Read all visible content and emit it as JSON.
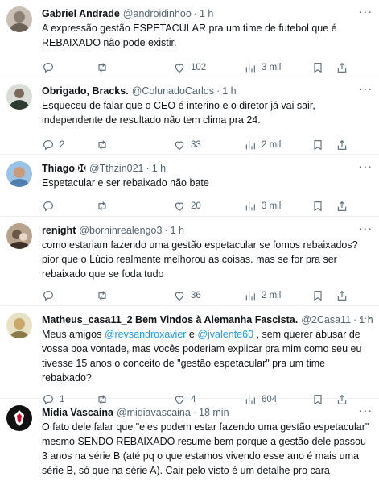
{
  "tweets": [
    {
      "name": "Gabriel Andrade",
      "handle": "@androidinhoo",
      "time": "1 h",
      "text": "A expressão gestão ESPETACULAR pra um time de futebol que é REBAIXADO não pode existir.",
      "replies": "",
      "retweets": "",
      "likes": "102",
      "views": "3 mil",
      "avatar_color": "#8c7f73"
    },
    {
      "name": "Obrigado, Bracks.",
      "handle": "@ColunadoCarlos",
      "time": "1 h",
      "text": "Esqueceu de falar que o CEO é interino e o diretor já vai sair, independente de resultado não tem clima pra 24.",
      "replies": "2",
      "retweets": "",
      "likes": "33",
      "views": "2 mil",
      "avatar_color": "#2c3a2f"
    },
    {
      "name": "Thiago ✠",
      "handle": "@Tthzin021",
      "time": "1 h",
      "text": "Espetacular e ser rebaixado não bate",
      "replies": "",
      "retweets": "",
      "likes": "20",
      "views": "3 mil",
      "avatar_color": "#4f7fb0"
    },
    {
      "name": "renight",
      "handle": "@borninrealengo3",
      "time": "1 h",
      "text": "como estariam fazendo uma gestão espetacular se fomos rebaixados? pior que o Lúcio realmente melhorou as coisas. mas se for pra ser rebaixado que se foda tudo",
      "replies": "",
      "retweets": "",
      "likes": "36",
      "views": "2 mil",
      "avatar_color": "#6b5848"
    },
    {
      "name": "Matheus_casa11_2 Bem Vindos à Alemanha Fascista.",
      "handle": "@2Casa11",
      "time": "1 h",
      "text_pre": "Meus amigos ",
      "mention1": "@revsandroxavier",
      "text_mid": " e ",
      "mention2": "@jvalente60",
      "text_post": " , sem querer abusar de vossa boa vontade, mas vocês poderiam explicar pra mim como seu eu tivesse 15 anos o conceito de \"gestão espetacular\" pra um time rebaixado?",
      "replies": "1",
      "retweets": "",
      "likes": "4",
      "views": "604",
      "avatar_color": "#c9a86a"
    },
    {
      "name": "Mídia Vascaína",
      "handle": "@midiavascaina",
      "time": "18 min",
      "text": "O fato dele falar que \"eles podem estar fazendo uma gestão espetacular\" mesmo SENDO REBAIXADO resume bem porque a gestão dele passou 3 anos na série B (até pq o que estamos vivendo esse ano é mais uma série B, só que na série A). Cair pelo visto é um detalhe pro cara",
      "avatar_color": "#111111"
    }
  ],
  "icons": {
    "reply": "reply-icon",
    "retweet": "retweet-icon",
    "like": "heart-icon",
    "views": "views-icon",
    "bookmark": "bookmark-icon",
    "share": "share-icon",
    "more": "more-icon"
  },
  "dot": "·",
  "more_glyph": "···"
}
